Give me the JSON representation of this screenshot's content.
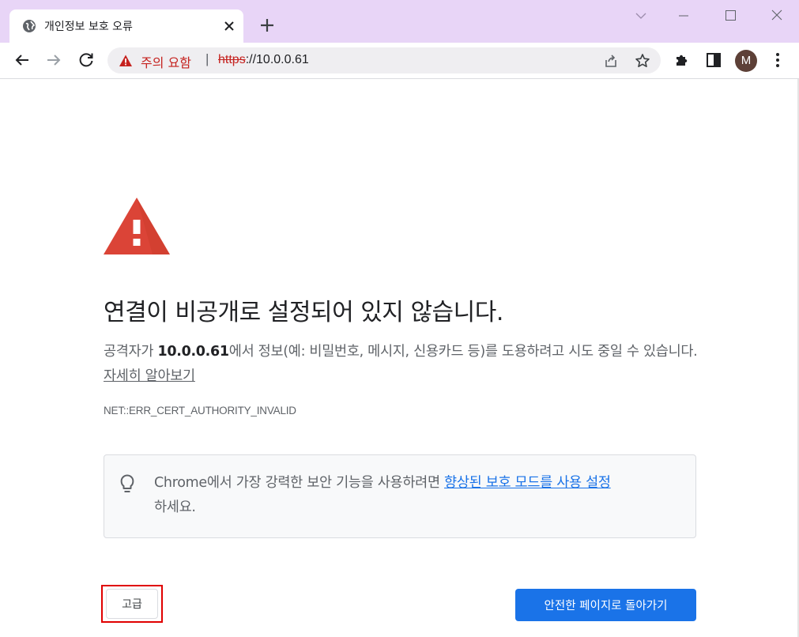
{
  "tab": {
    "title": "개인정보 보호 오류"
  },
  "toolbar": {
    "security_status": "주의 요함",
    "separator": "|",
    "url_scheme": "https",
    "url_rest": "://10.0.0.61",
    "avatar_initial": "M"
  },
  "icons": {
    "favicon": "globe-icon",
    "tab_close": "close-icon",
    "new_tab": "plus-icon",
    "minimize": "minimize-icon",
    "chevron": "chevron-down-icon",
    "maximize": "maximize-icon",
    "window_close": "close-icon",
    "back": "arrow-left-icon",
    "forward": "arrow-right-icon",
    "reload": "reload-icon",
    "warning": "warning-triangle-icon",
    "share": "share-icon",
    "bookmark": "star-icon",
    "extensions": "puzzle-icon",
    "side_panel": "side-panel-icon",
    "menu": "kebab-menu-icon",
    "bulb": "lightbulb-icon"
  },
  "colors": {
    "titlebar": "#e8d5f7",
    "warning_red": "#db4437",
    "status_red": "#c5221f",
    "link_blue": "#1a73e8",
    "highlight_box": "#e00000"
  },
  "content": {
    "heading": "연결이 비공개로 설정되어 있지 않습니다.",
    "desc_prefix": "공격자가 ",
    "desc_host": "10.0.0.61",
    "desc_suffix": "에서 정보(예: 비밀번호, 메시지, 신용카드 등)를 도용하려고 시도 중일 수 있습니다. ",
    "learn_more": "자세히 알아보기",
    "error_code": "NET::ERR_CERT_AUTHORITY_INVALID",
    "info_prefix": "Chrome에서 가장 강력한 보안 기능을 사용하려면 ",
    "info_link": "향상된 보호 모드를 사용 설정",
    "info_suffix": "하세요.",
    "advanced_button": "고급",
    "back_button": "안전한 페이지로 돌아가기"
  }
}
